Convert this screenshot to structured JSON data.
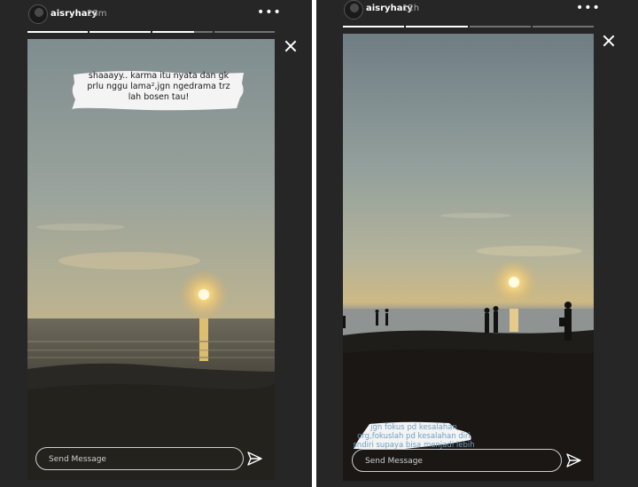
{
  "stories": [
    {
      "username": "aisryhary",
      "timestamp": "28m",
      "avatar_icon": "avatar-circle",
      "progress": [
        1,
        1,
        0.7,
        0
      ],
      "caption": "shaaayy.. karma itu nyata dan gk\nprlu nggu lama²,jgn ngedrama trz\nlah bosen tau!",
      "reply_placeholder": "Send Message"
    },
    {
      "username": "aisryhary",
      "timestamp": "12h",
      "avatar_icon": "avatar-circle",
      "progress": [
        1,
        1,
        0,
        0
      ],
      "caption": "jgn fokus pd kesalahan\norg,fokuslah pd kesalahan diri\nsndiri supaya bisa menjadi lebih",
      "reply_placeholder": "Send Message"
    }
  ],
  "icons": {
    "more": "more-horizontal-icon",
    "close": "close-icon",
    "send": "send-icon"
  },
  "colors": {
    "panel_bg": "#262626",
    "text": "#ffffff",
    "muted": "#a8a8a8",
    "caption_blue": "#6f9fc0"
  }
}
